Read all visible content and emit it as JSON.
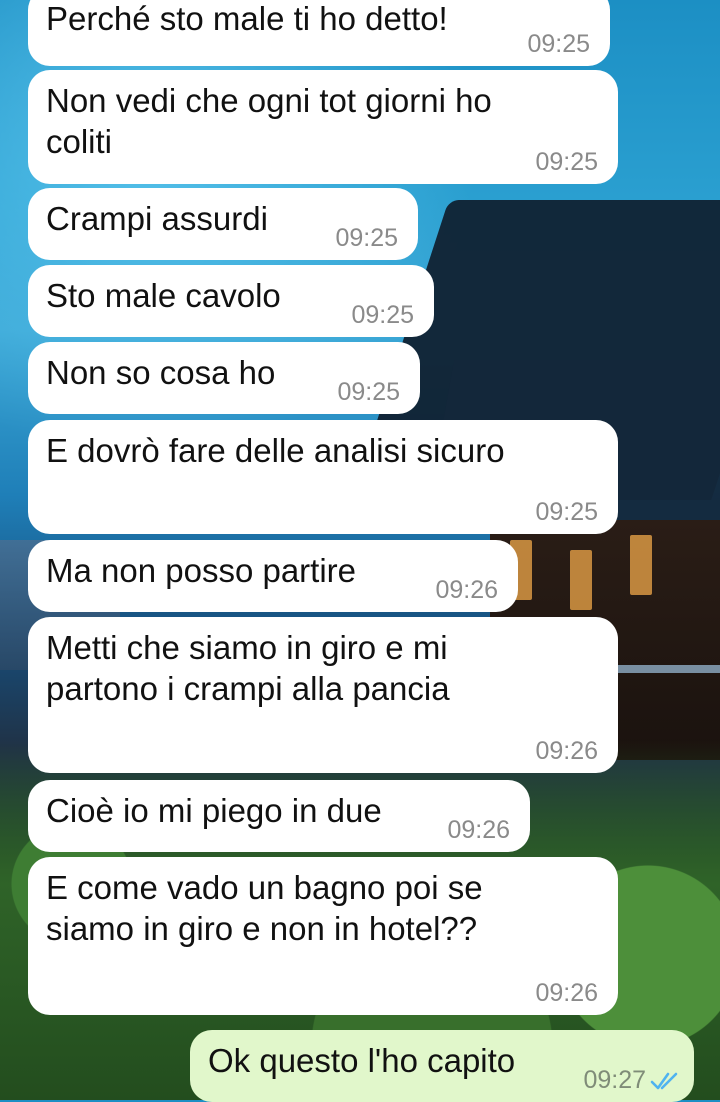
{
  "chat": {
    "messages": [
      {
        "text": "Perché sto male ti ho detto!",
        "time": "09:25",
        "direction": "in"
      },
      {
        "text": "Non vedi che ogni tot giorni ho\ncoliti",
        "time": "09:25",
        "direction": "in"
      },
      {
        "text": "Crampi assurdi",
        "time": "09:25",
        "direction": "in"
      },
      {
        "text": "Sto male cavolo",
        "time": "09:25",
        "direction": "in"
      },
      {
        "text": "Non so cosa ho",
        "time": "09:25",
        "direction": "in"
      },
      {
        "text": "E dovrò fare delle analisi sicuro",
        "time": "09:25",
        "direction": "in"
      },
      {
        "text": "Ma non posso partire",
        "time": "09:26",
        "direction": "in"
      },
      {
        "text": "Metti che siamo in giro e mi\npartono i crampi alla pancia",
        "time": "09:26",
        "direction": "in"
      },
      {
        "text": "Cioè io mi piego in due",
        "time": "09:26",
        "direction": "in"
      },
      {
        "text": "E come vado un bagno poi se\nsiamo in giro e non in hotel??",
        "time": "09:26",
        "direction": "in"
      },
      {
        "text": "Ok questo l'ho capito",
        "time": "09:27",
        "direction": "out",
        "status_icon": "double-check-read-icon"
      }
    ]
  },
  "colors": {
    "incoming_bubble": "#ffffff",
    "outgoing_bubble": "#e1f7cb",
    "read_ticks": "#4fb3f0"
  }
}
